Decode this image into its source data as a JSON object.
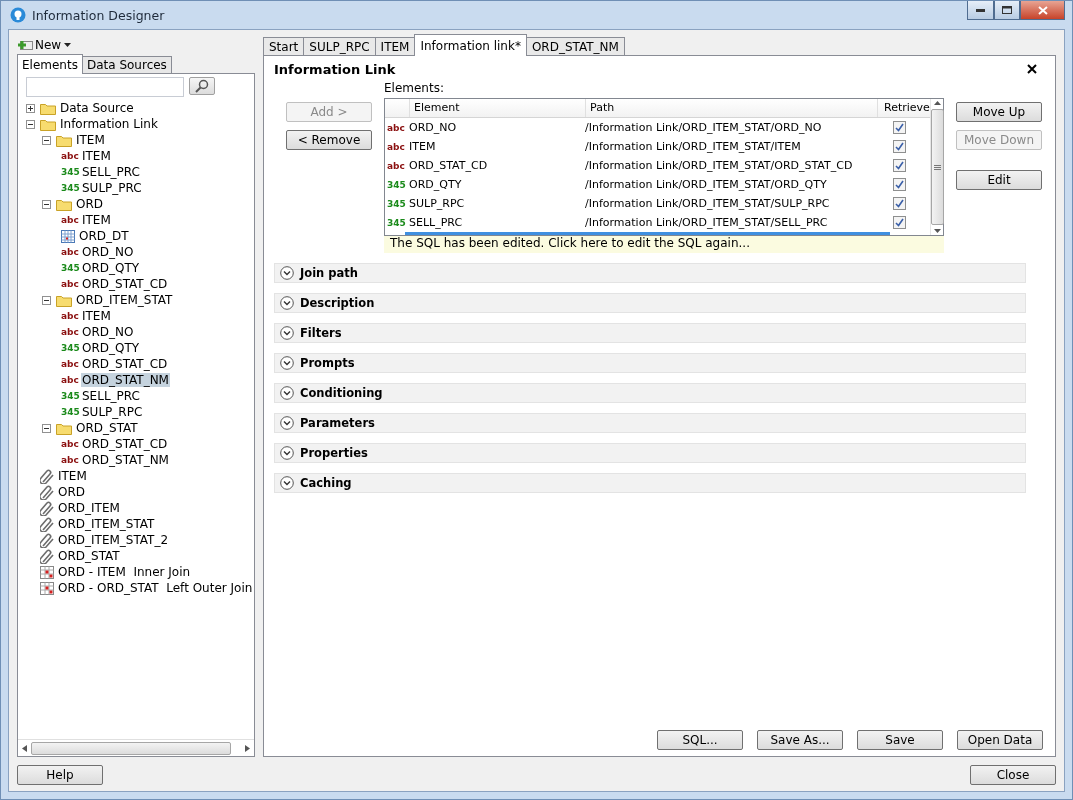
{
  "window": {
    "title": "Information Designer"
  },
  "new_button": {
    "label": "New"
  },
  "left_tabs": [
    {
      "label": "Elements",
      "selected": true
    },
    {
      "label": "Data Sources",
      "selected": false
    }
  ],
  "tree": [
    {
      "kind": "folder",
      "label": "Data Source",
      "expanded": false,
      "selected": false
    },
    {
      "kind": "folder",
      "label": "Information Link",
      "expanded": true,
      "selected": false,
      "children": [
        {
          "kind": "folder",
          "label": "ITEM",
          "expanded": true,
          "selected": false,
          "children": [
            {
              "kind": "text",
              "type_label": "abc",
              "label": "ITEM",
              "selected": false
            },
            {
              "kind": "number",
              "type_label": "345",
              "label": "SELL_PRC",
              "selected": false
            },
            {
              "kind": "number",
              "type_label": "345",
              "label": "SULP_PRC",
              "selected": false
            }
          ]
        },
        {
          "kind": "folder",
          "label": "ORD",
          "expanded": true,
          "selected": false,
          "children": [
            {
              "kind": "text",
              "type_label": "abc",
              "label": "ITEM",
              "selected": false
            },
            {
              "kind": "date",
              "label": "ORD_DT",
              "selected": false
            },
            {
              "kind": "text",
              "type_label": "abc",
              "label": "ORD_NO",
              "selected": false
            },
            {
              "kind": "number",
              "type_label": "345",
              "label": "ORD_QTY",
              "selected": false
            },
            {
              "kind": "text",
              "type_label": "abc",
              "label": "ORD_STAT_CD",
              "selected": false
            }
          ]
        },
        {
          "kind": "folder",
          "label": "ORD_ITEM_STAT",
          "expanded": true,
          "selected": false,
          "children": [
            {
              "kind": "text",
              "type_label": "abc",
              "label": "ITEM",
              "selected": false
            },
            {
              "kind": "text",
              "type_label": "abc",
              "label": "ORD_NO",
              "selected": false
            },
            {
              "kind": "number",
              "type_label": "345",
              "label": "ORD_QTY",
              "selected": false
            },
            {
              "kind": "text",
              "type_label": "abc",
              "label": "ORD_STAT_CD",
              "selected": false
            },
            {
              "kind": "text",
              "type_label": "abc",
              "label": "ORD_STAT_NM",
              "selected": true
            },
            {
              "kind": "number",
              "type_label": "345",
              "label": "SELL_PRC",
              "selected": false
            },
            {
              "kind": "number",
              "type_label": "345",
              "label": "SULP_RPC",
              "selected": false
            }
          ]
        },
        {
          "kind": "folder",
          "label": "ORD_STAT",
          "expanded": true,
          "selected": false,
          "children": [
            {
              "kind": "text",
              "type_label": "abc",
              "label": "ORD_STAT_CD",
              "selected": false
            },
            {
              "kind": "text",
              "type_label": "abc",
              "label": "ORD_STAT_NM",
              "selected": false
            }
          ]
        }
      ]
    },
    {
      "kind": "link",
      "label": "ITEM",
      "selected": false
    },
    {
      "kind": "link",
      "label": "ORD",
      "selected": false
    },
    {
      "kind": "link",
      "label": "ORD_ITEM",
      "selected": false
    },
    {
      "kind": "link",
      "label": "ORD_ITEM_STAT",
      "selected": false
    },
    {
      "kind": "link",
      "label": "ORD_ITEM_STAT_2",
      "selected": false
    },
    {
      "kind": "link",
      "label": "ORD_STAT",
      "selected": false
    },
    {
      "kind": "join",
      "label": "ORD - ITEM  Inner Join",
      "selected": false
    },
    {
      "kind": "join",
      "label": "ORD - ORD_STAT  Left Outer Join",
      "selected": false
    }
  ],
  "doc_tabs": [
    {
      "label": "Start",
      "selected": false
    },
    {
      "label": "SULP_RPC",
      "selected": false
    },
    {
      "label": "ITEM",
      "selected": false
    },
    {
      "label": "Information link*",
      "selected": true
    },
    {
      "label": "ORD_STAT_NM",
      "selected": false
    }
  ],
  "panel": {
    "title": "Information Link",
    "left_buttons": [
      {
        "label": "Add >",
        "disabled": true
      },
      {
        "label": "< Remove",
        "disabled": false
      }
    ],
    "elements_label": "Elements:",
    "columns": [
      "Element",
      "Path",
      "Retrieve"
    ],
    "rows": [
      {
        "type_label": "abc",
        "kind": "text",
        "element": "ORD_NO",
        "path": "/Information Link/ORD_ITEM_STAT/ORD_NO",
        "retrieve": true
      },
      {
        "type_label": "abc",
        "kind": "text",
        "element": "ITEM",
        "path": "/Information Link/ORD_ITEM_STAT/ITEM",
        "retrieve": true
      },
      {
        "type_label": "abc",
        "kind": "text",
        "element": "ORD_STAT_CD",
        "path": "/Information Link/ORD_ITEM_STAT/ORD_STAT_CD",
        "retrieve": true
      },
      {
        "type_label": "345",
        "kind": "number",
        "element": "ORD_QTY",
        "path": "/Information Link/ORD_ITEM_STAT/ORD_QTY",
        "retrieve": true
      },
      {
        "type_label": "345",
        "kind": "number",
        "element": "SULP_RPC",
        "path": "/Information Link/ORD_ITEM_STAT/SULP_RPC",
        "retrieve": true
      },
      {
        "type_label": "345",
        "kind": "number",
        "element": "SELL_PRC",
        "path": "/Information Link/ORD_ITEM_STAT/SELL_PRC",
        "retrieve": true
      }
    ],
    "right_buttons": [
      {
        "label": "Move Up",
        "disabled": false
      },
      {
        "label": "Move Down",
        "disabled": true
      },
      {
        "label": "Edit",
        "disabled": false
      }
    ],
    "sql_notice": "The SQL has been edited. Click here to edit the SQL again...",
    "sections": [
      {
        "label": "Join path",
        "expanded": false
      },
      {
        "label": "Description",
        "expanded": false
      },
      {
        "label": "Filters",
        "expanded": false
      },
      {
        "label": "Prompts",
        "expanded": false
      },
      {
        "label": "Conditioning",
        "expanded": false
      },
      {
        "label": "Parameters",
        "expanded": false
      },
      {
        "label": "Properties",
        "expanded": false
      },
      {
        "label": "Caching",
        "expanded": false
      }
    ],
    "bottom_buttons": [
      "SQL...",
      "Save As...",
      "Save",
      "Open Data"
    ]
  },
  "footer": {
    "help": "Help",
    "close": "Close"
  }
}
